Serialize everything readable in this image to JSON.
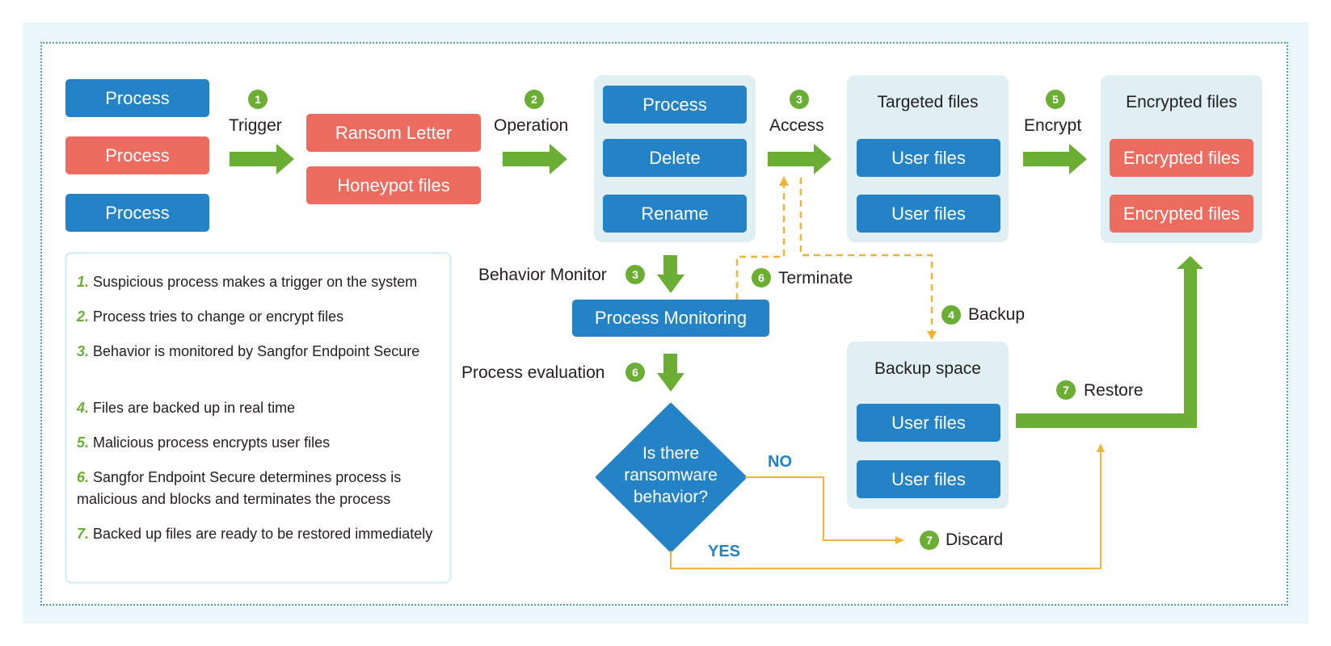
{
  "colors": {
    "blue": "#2383c6",
    "red": "#ec6c60",
    "green": "#6aaf33",
    "orange": "#f0b43c",
    "panel": "#dfeff4",
    "background": "#eaf6f9"
  },
  "sources": {
    "processes": [
      "Process",
      "Process",
      "Process"
    ]
  },
  "steps": {
    "trigger": {
      "num": "1",
      "label": "Trigger"
    },
    "operation": {
      "num": "2",
      "label": "Operation"
    },
    "access": {
      "num": "3",
      "label": "Access"
    },
    "encrypt": {
      "num": "5",
      "label": "Encrypt"
    },
    "behavior_monitor": {
      "num": "3",
      "label": "Behavior Monitor"
    },
    "process_evaluation": {
      "num": "6",
      "label": "Process evaluation"
    },
    "terminate": {
      "num": "6",
      "label": "Terminate"
    },
    "backup": {
      "num": "4",
      "label": "Backup"
    },
    "restore": {
      "num": "7",
      "label": "Restore"
    },
    "discard": {
      "num": "7",
      "label": "Discard"
    }
  },
  "trigger_targets": [
    "Ransom Letter",
    "Honeypot files"
  ],
  "operations_panel": {
    "items": [
      "Process",
      "Delete",
      "Rename"
    ]
  },
  "targeted_panel": {
    "title": "Targeted files",
    "items": [
      "User files",
      "User files"
    ]
  },
  "encrypted_panel": {
    "title": "Encrypted files",
    "items": [
      "Encrypted files",
      "Encrypted files"
    ]
  },
  "backup_panel": {
    "title": "Backup space",
    "items": [
      "User files",
      "User files"
    ]
  },
  "process_monitoring": "Process Monitoring",
  "decision": {
    "line1": "Is there",
    "line2": "ransomware",
    "line3": "behavior?",
    "no": "NO",
    "yes": "YES"
  },
  "legend": [
    {
      "num": "1.",
      "text": "Suspicious process makes a trigger on the system"
    },
    {
      "num": "2.",
      "text": "Process tries to change or encrypt files"
    },
    {
      "num": "3.",
      "text": "Behavior is monitored by Sangfor Endpoint Secure"
    },
    {
      "num": "4.",
      "text": "Files are backed up in real time"
    },
    {
      "num": "5.",
      "text": "Malicious process encrypts user files"
    },
    {
      "num": "6.",
      "text": "Sangfor Endpoint Secure determines process is malicious and blocks and terminates the process"
    },
    {
      "num": "7.",
      "text": "Backed up files are ready to be restored immediately"
    }
  ]
}
